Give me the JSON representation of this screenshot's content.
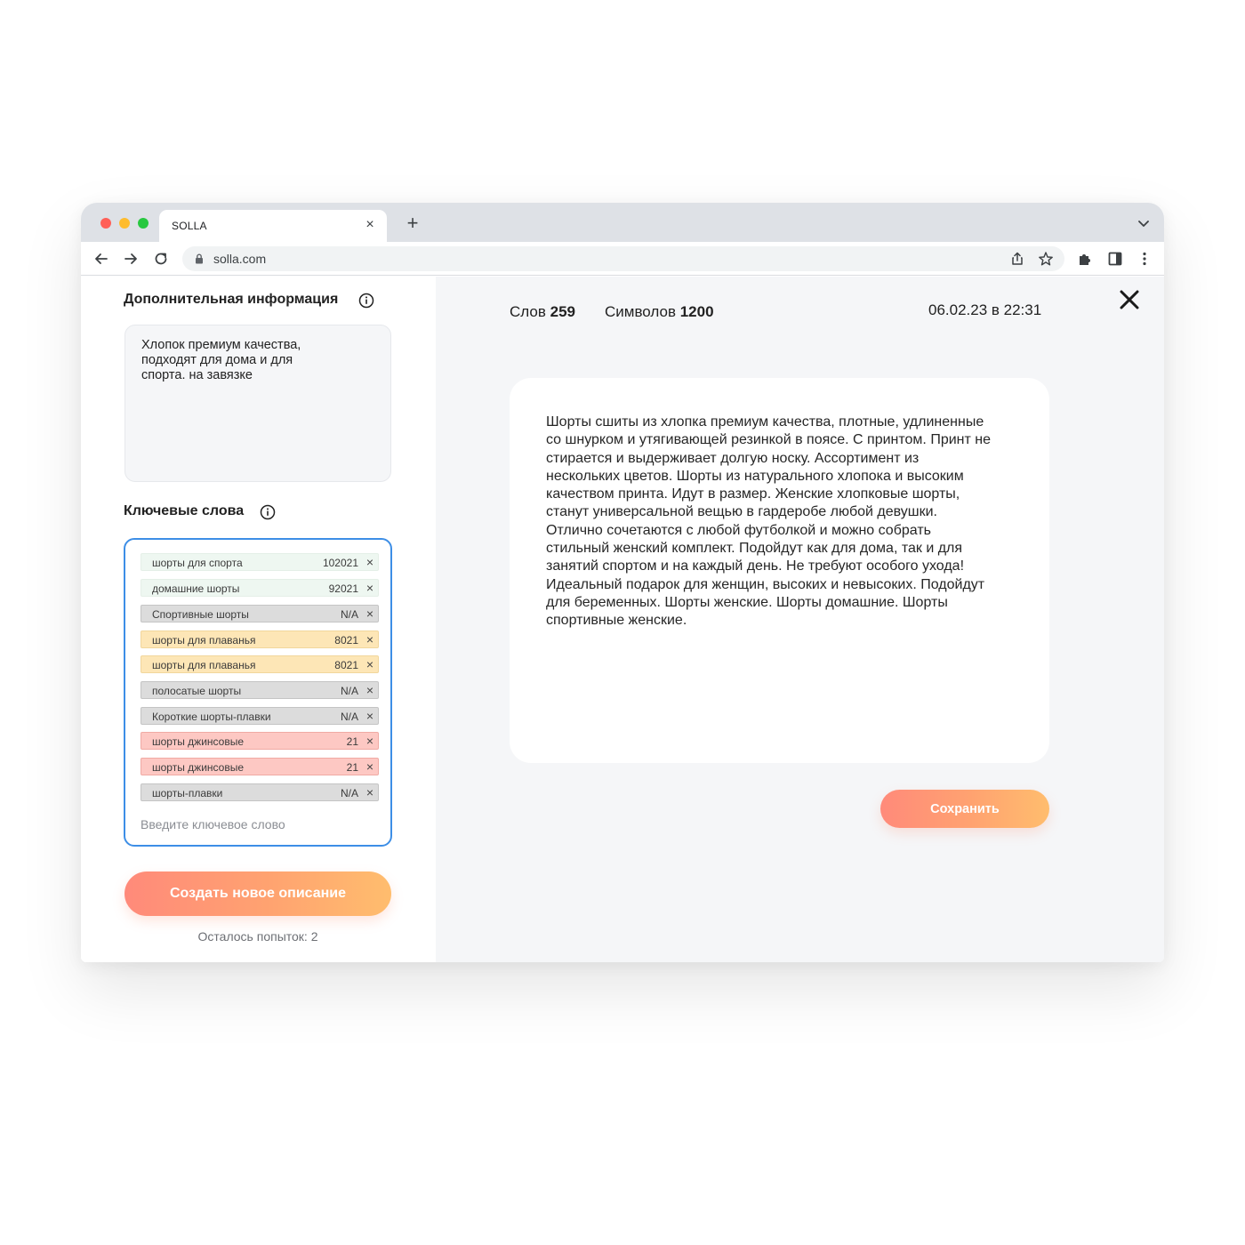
{
  "browser": {
    "tab_title": "SOLLA",
    "url": "solla.com"
  },
  "left_panel": {
    "additional_info": {
      "title": "Дополнительная информация",
      "value": "Хлопок премиум качества,\nподходят для дома и для\nспорта. на завязке"
    },
    "keywords": {
      "title": "Ключевые слова",
      "chips": [
        {
          "label": "шорты для спорта",
          "value": "102021",
          "color": "green"
        },
        {
          "label": "домашние шорты",
          "value": "92021",
          "color": "green"
        },
        {
          "label": "Спортивные шорты",
          "value": "N/A",
          "color": "grey"
        },
        {
          "label": "шорты для плаванья",
          "value": "8021",
          "color": "yellow"
        },
        {
          "label": "шорты для плаванья",
          "value": "8021",
          "color": "yellow"
        },
        {
          "label": "полосатые шорты",
          "value": "N/A",
          "color": "grey"
        },
        {
          "label": "Короткие шорты-плавки",
          "value": "N/A",
          "color": "grey"
        },
        {
          "label": "шорты джинсовые",
          "value": "21",
          "color": "red"
        },
        {
          "label": "шорты джинсовые",
          "value": "21",
          "color": "red"
        },
        {
          "label": "шорты-плавки",
          "value": "N/A",
          "color": "grey"
        }
      ],
      "input_placeholder": "Введите ключевое слово"
    },
    "create_button": "Создать новое описание",
    "attempts_text": "Осталось попыток: 2"
  },
  "right_panel": {
    "words_label": "Слов",
    "words_count": "259",
    "chars_label": "Символов",
    "chars_count": "1200",
    "datetime": "06.02.23 в 22:31",
    "description": "Шорты сшиты из хлопка премиум качества, плотные, удлиненные со шнурком и утягивающей резинкой в поясе. С принтом. Принт не стирается и выдерживает долгую носку. Ассортимент из нескольких цветов. Шорты из натурального хлопока и высоким качеством принта. Идут в размер. Женские хлопковые шорты, станут универсальной вещью в гардеробе любой девушки. Отлично сочетаются с любой футболкой и можно собрать стильный женский комплект. Подойдут как для дома, так и для занятий спортом и на каждый день. Не требуют особого ухода! Идеальный подарок для женщин, высоких и невысоких. Подойдут для беременных. Шорты женские. Шорты домашние. Шорты спортивные женские.",
    "save_button": "Сохранить"
  },
  "colors": {
    "accent_gradient_start": "#ff8a7a",
    "accent_gradient_end": "#ffbd6e",
    "keyword_box_border": "#3d8ee6",
    "chip_green": "#eef7f1",
    "chip_grey": "#dcdcdc",
    "chip_yellow": "#fde6b6",
    "chip_red": "#fdc8c3"
  },
  "icons": {
    "info": "info-circle-icon",
    "close": "close-x-icon",
    "chip_remove": "x-icon"
  }
}
